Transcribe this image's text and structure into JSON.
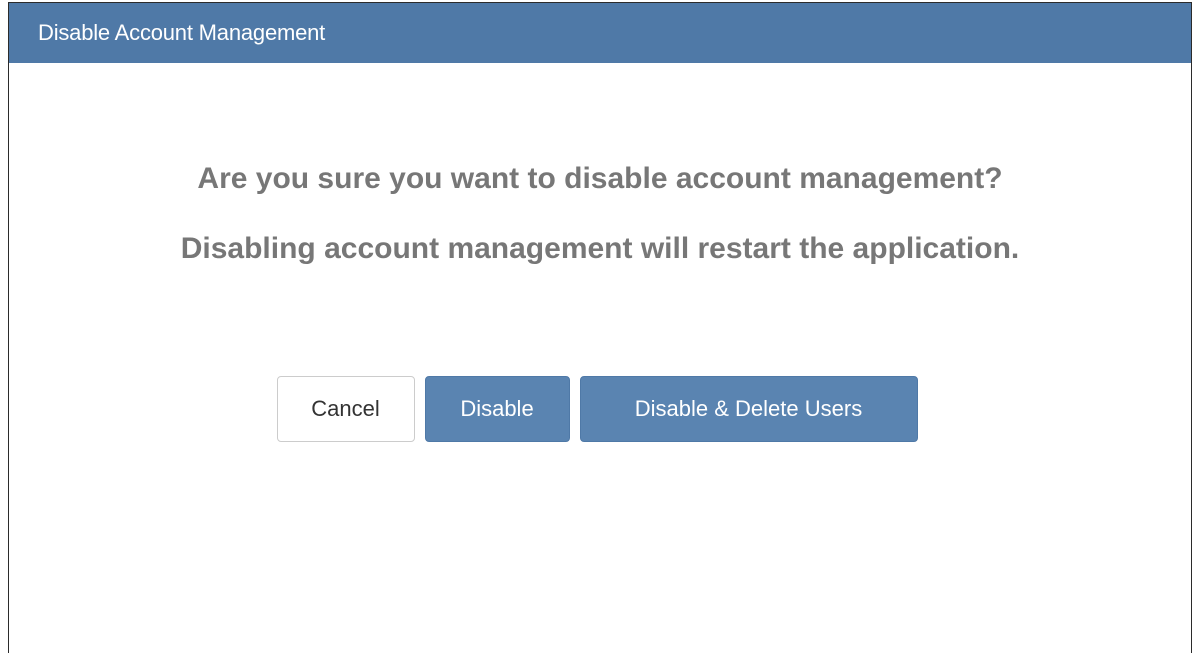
{
  "dialog": {
    "title": "Disable Account Management",
    "message_confirm": "Are you sure you want to disable account management?",
    "message_restart": "Disabling account management will restart the application.",
    "buttons": {
      "cancel": "Cancel",
      "disable": "Disable",
      "disable_delete": "Disable & Delete Users"
    }
  },
  "colors": {
    "header": "#4f79a7",
    "primary_button": "#5a84b1",
    "message_text": "#777777"
  }
}
